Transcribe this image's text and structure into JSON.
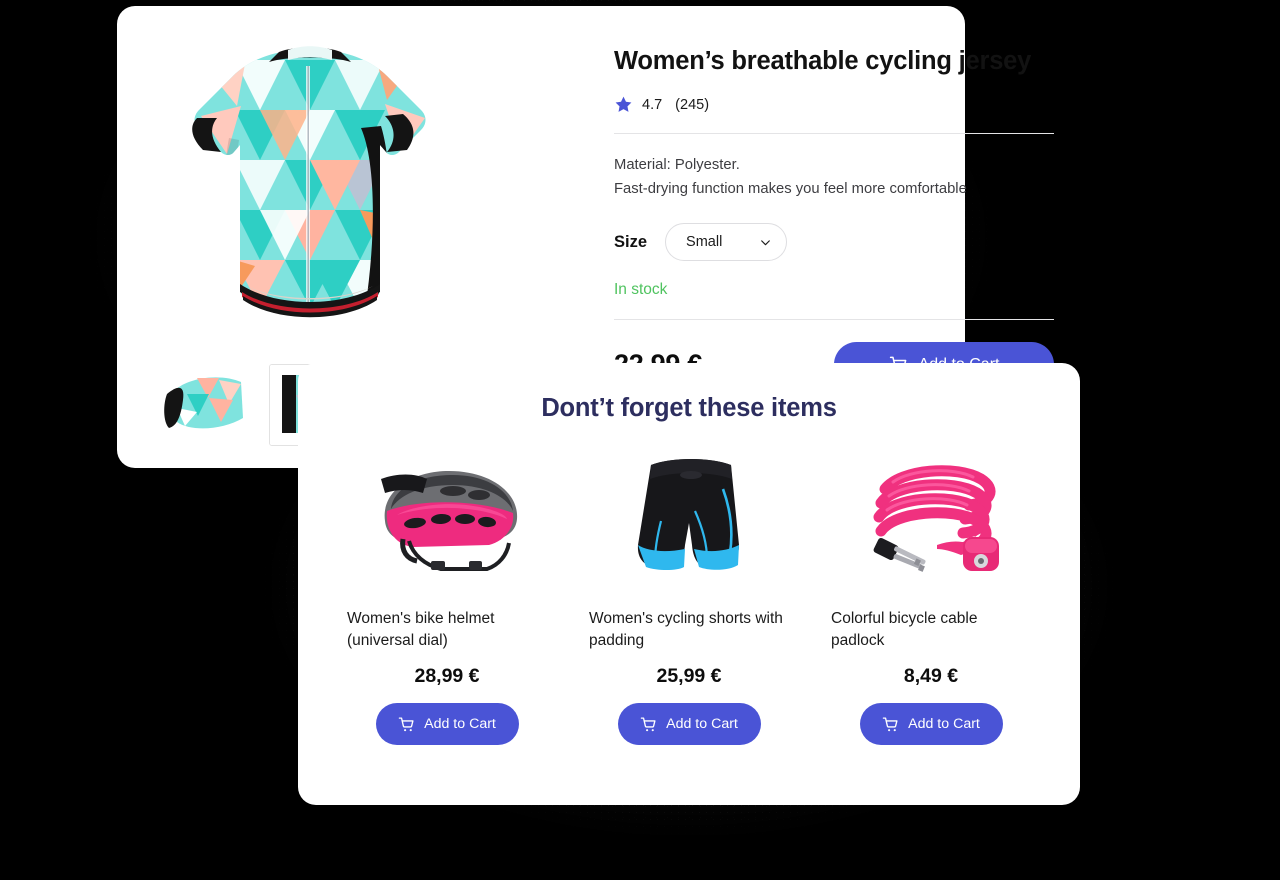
{
  "product": {
    "title": "Women’s breathable cycling jersey",
    "rating_value": "4.7",
    "rating_count": "(245)",
    "spec_line_1": "Material: Polyester.",
    "spec_line_2": "Fast-drying function makes you feel more comfortable",
    "size_label": "Size",
    "size_value": "Small",
    "stock_status": "In stock",
    "price": "22,99 €",
    "add_to_cart_label": "Add to Cart",
    "star_icon": "star-icon",
    "chevron_icon": "chevron-down-icon",
    "cart_icon": "cart-icon",
    "image_alt": "cycling-jersey-teal-geometric",
    "thumbnails": [
      {
        "alt": "jersey-sleeve-detail-1"
      },
      {
        "alt": "jersey-sleeve-detail-2"
      }
    ]
  },
  "recommendations": {
    "heading": "Dont’t forget these items",
    "items": [
      {
        "name": "Women's bike helmet (universal dial)",
        "price": "28,99 €",
        "add_to_cart_label": "Add to Cart",
        "image_alt": "pink-gray-bike-helmet"
      },
      {
        "name": "Women's cycling shorts with padding",
        "price": "25,99 €",
        "add_to_cart_label": "Add to Cart",
        "image_alt": "black-cyan-cycling-shorts"
      },
      {
        "name": "Colorful bicycle cable padlock",
        "price": "8,49 €",
        "add_to_cart_label": "Add to Cart",
        "image_alt": "pink-coiled-cable-lock-with-keys"
      }
    ]
  },
  "colors": {
    "accent_purple": "#4a54d6",
    "heading_navy": "#2d2e5f",
    "in_stock_green": "#4fc35f",
    "background": "#000000",
    "card": "#ffffff"
  }
}
